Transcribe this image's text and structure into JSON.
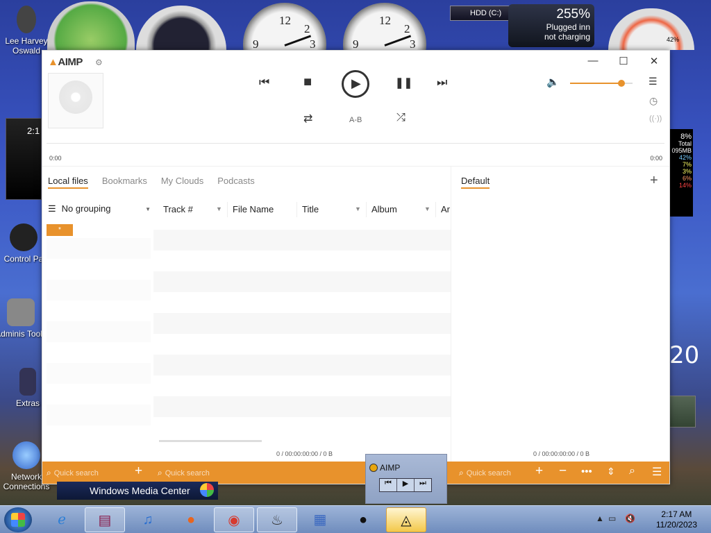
{
  "desktop": {
    "icons": [
      {
        "label": "Lee Harvey Oswald"
      },
      {
        "label": "Control Pa"
      },
      {
        "label": "Adminis Tools"
      },
      {
        "label": "Extras"
      },
      {
        "label": "Network Connections"
      }
    ],
    "gadgets": {
      "cpu_clock": "2:1",
      "hdd_label": "HDD (C:)",
      "battery_pct": "255%",
      "battery_line1": "Plugged inn",
      "battery_line2": "not charging",
      "meter_pct": "42%",
      "cpu_pct": "8%",
      "mem_total": "Total",
      "mem_mb": "095MB",
      "mem_rows": [
        "42%",
        "7%",
        "3%",
        "6%",
        "14%"
      ],
      "clock_hour_20": "20",
      "clock_numerals": [
        "12",
        "3",
        "9",
        "2",
        "12",
        "3",
        "9",
        "2"
      ]
    }
  },
  "aimp": {
    "logo": "AIMP",
    "window_controls": {
      "minimize": "—",
      "maximize": "☐",
      "close": "✕"
    },
    "player": {
      "prev": "⏮",
      "stop": "■",
      "play": "▶",
      "pause": "❚❚",
      "next": "⏭",
      "repeat": "⇄",
      "ab": "A-B",
      "shuffle": "⤮",
      "time_start": "0:00",
      "time_end": "0:00",
      "volume_pct": 82
    },
    "tabs": [
      "Local files",
      "Bookmarks",
      "My Clouds",
      "Podcasts"
    ],
    "active_tab": "Local files",
    "grouping": "No grouping",
    "group_item": "*",
    "columns": [
      "Track #",
      "File Name",
      "Title",
      "Album",
      "Ar"
    ],
    "left_status": "0 / 00:00:00:00 / 0 B",
    "playlist_tab": "Default",
    "playlist_status": "0 / 00:00:00:00 / 0 B",
    "quick_search_1": "Quick search",
    "quick_search_2": "Quick search",
    "quick_search_3": "Quick search"
  },
  "mini_player": {
    "title": "AIMP"
  },
  "wmc": {
    "label": "Windows Media Center"
  },
  "taskbar": {
    "time": "2:17 AM",
    "date": "11/20/2023"
  }
}
